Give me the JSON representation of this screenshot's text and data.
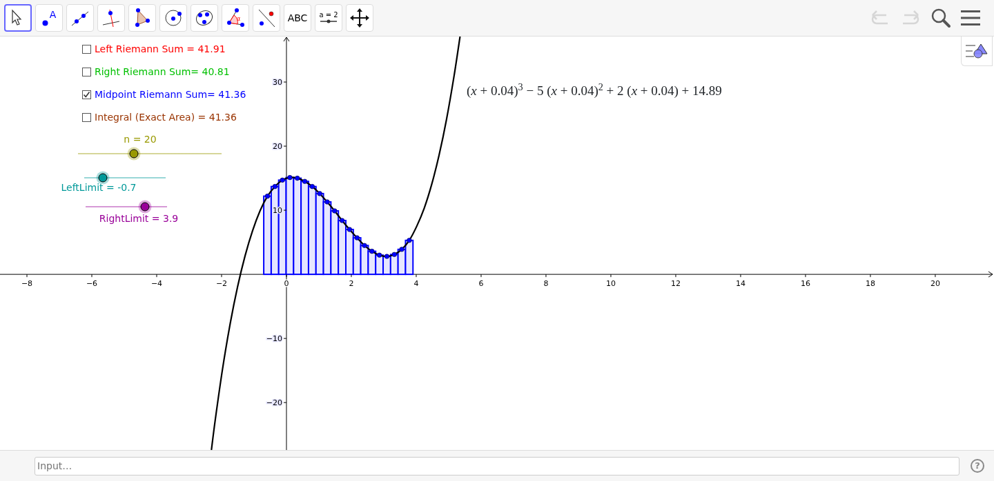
{
  "toolbar": {
    "tools": [
      {
        "kind": "move",
        "selected": true
      },
      {
        "kind": "point",
        "label": "A",
        "selected": false
      },
      {
        "kind": "line",
        "selected": false
      },
      {
        "kind": "perpendicular",
        "selected": false
      },
      {
        "kind": "polygon",
        "selected": false
      },
      {
        "kind": "circle",
        "selected": false
      },
      {
        "kind": "conic",
        "selected": false
      },
      {
        "kind": "angle",
        "label": "α",
        "selected": false
      },
      {
        "kind": "reflect",
        "selected": false
      },
      {
        "kind": "text",
        "label": "ABC",
        "selected": false
      },
      {
        "kind": "slider",
        "label": "a = 2",
        "selected": false
      },
      {
        "kind": "move_view",
        "selected": false
      }
    ],
    "undo": {
      "disabled": true
    },
    "redo": {
      "disabled": true
    }
  },
  "checkboxes": [
    {
      "label": "Left Riemann Sum = 41.91",
      "color": "#ff0000",
      "checked": false
    },
    {
      "label": "Right Riemann Sum= 40.81",
      "color": "#00c000",
      "checked": false
    },
    {
      "label": "Midpoint Riemann Sum= 41.36",
      "color": "#0000ff",
      "checked": true
    },
    {
      "label": "Integral (Exact Area) = 41.36",
      "color": "#993300",
      "checked": false
    }
  ],
  "sliders": [
    {
      "label": "n = 20",
      "color": "#999900",
      "level": 0.38
    },
    {
      "label": "LeftLimit = -0.7",
      "color": "#009999",
      "level": 0.19
    },
    {
      "label": "RightLimit = 3.9",
      "color": "#990099",
      "level": 0.76
    }
  ],
  "formula": "(*x* + 0.04)$^{3}$ − 5  (*x* + 0.04)$^{2}$ + 2  (*x* + 0.04) + 14.89",
  "graph": {
    "chart_data": {
      "type": "bar",
      "xlim": [
        -8.83,
        21.81
      ],
      "ylim": [
        -27.4,
        37.1
      ],
      "xticks": [
        -8,
        -6,
        -4,
        -2,
        0,
        2,
        4,
        6,
        8,
        10,
        12,
        14,
        16,
        18,
        20
      ],
      "yticks": [
        -20,
        -10,
        10,
        20,
        30
      ],
      "x": [
        -2.313,
        -2.195,
        -1.965,
        -1.735,
        -1.505,
        -1.275,
        -1.045,
        -0.815,
        -0.585,
        -0.355,
        -0.125,
        0.105,
        0.335,
        0.565,
        0.795,
        1.025,
        1.255,
        1.485,
        1.715,
        1.945,
        2.175,
        2.405,
        2.635,
        2.865,
        3.095,
        3.325,
        3.555,
        3.785,
        4.015,
        4.245,
        4.475,
        4.705,
        4.935,
        5.165,
        5.351
      ],
      "series": [
        {
          "color": "#0000ff",
          "values": [
            null,
            null,
            null,
            null,
            null,
            null,
            null,
            null,
            12.2,
            13.7,
            14.7,
            15.1,
            15,
            14.5,
            13.7,
            12.6,
            11.3,
            9.9,
            8.4,
            7,
            5.7,
            4.5,
            3.6,
            3,
            2.8,
            3.1,
            3.9,
            5.3,
            null,
            null,
            null,
            null,
            null,
            null,
            null
          ]
        },
        {
          "type": "line",
          "color": "#000000",
          "values": [
            -27.4,
            -22.7,
            -14.6,
            -7.7,
            -1.9,
            2.9,
            6.8,
            9.9,
            12.2,
            13.7,
            14.7,
            15.1,
            15,
            14.5,
            13.7,
            12.6,
            11.3,
            9.9,
            8.4,
            7,
            5.7,
            4.5,
            3.6,
            3,
            2.8,
            3.1,
            3.9,
            5.3,
            7.5,
            10.3,
            14,
            18.6,
            24.2,
            30.9,
            37.1
          ]
        }
      ]
    }
  },
  "input_bar": {
    "placeholder": "Input…",
    "help": "?"
  }
}
